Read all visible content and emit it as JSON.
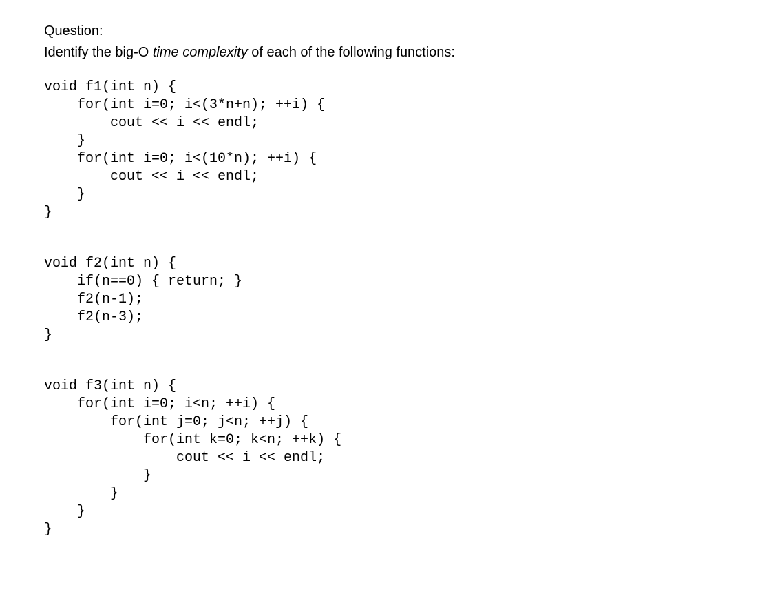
{
  "question": {
    "header": "Question:",
    "prompt_before": "Identify the big-O ",
    "prompt_italic": "time complexity",
    "prompt_after": " of each of the following functions:"
  },
  "code": {
    "f1": "void f1(int n) {\n    for(int i=0; i<(3*n+n); ++i) {\n        cout << i << endl;\n    }\n    for(int i=0; i<(10*n); ++i) {\n        cout << i << endl;\n    }\n}",
    "f2": "void f2(int n) {\n    if(n==0) { return; }\n    f2(n-1);\n    f2(n-3);\n}",
    "f3": "void f3(int n) {\n    for(int i=0; i<n; ++i) {\n        for(int j=0; j<n; ++j) {\n            for(int k=0; k<n; ++k) {\n                cout << i << endl;\n            }\n        }\n    }\n}"
  }
}
